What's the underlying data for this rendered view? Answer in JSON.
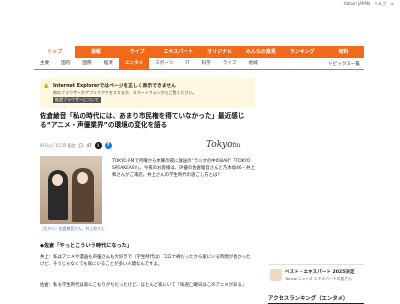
{
  "topbar": {
    "links": [
      "Yahoo! JAPAN",
      "ヘルプ",
      "◎"
    ]
  },
  "nav_primary": [
    "トップ",
    "速報",
    "ライブ",
    "エキスパート",
    "オリジナル",
    "みんなの意見",
    "ランキング",
    "有料"
  ],
  "nav_secondary": [
    "主要",
    "国内",
    "国際",
    "経済",
    "エンタメ",
    "スポーツ",
    "IT",
    "科学",
    "ライフ",
    "地域"
  ],
  "nav_secondary_active": "エンタメ",
  "topics_link": "トピックス一覧",
  "notice": {
    "heading": "Internet Explorerではページを正しく表示できません",
    "text": "他のブラウザーかアプリでアクセスするか、スマートフォンからご覧ください。",
    "link": "推奨ブラウザーについて"
  },
  "article": {
    "title": "佐倉綾音「私の時代には、あまり市民権を得ていなかった」最近感じる“アニメ・声優業界”の環境の変化を語る",
    "date": "9/3(火) 15:35 配信",
    "comments": "47",
    "logo": "Tokyo",
    "logo_suffix": "fm",
    "caption": "（左から）佐倉綾音さん、井上和さん",
    "lead": "TOKYO FMで月曜から木曜の夜に放送の“ラジオの中のBAR”「TOKYO SPEAKEASY」。今夜のお客様は、声優の佐倉綾音さんと乃木坂46・井上和さんがご来店。井上さんの学生時代の過ごし方とは？",
    "subhead": "◆佐倉「やっとこういう時代になった」",
    "body1": "井上：私はアニメや漫画も声優さんも大好きで（学生時代は）コロナ禍だったから家にいる時間が長かったけど、そうじゃなくても家にいることが多い人間なんですよ。",
    "body2": "佐倉：私も学生時代は家にこもりがちだったけど、ほとんど家にいて「毎週◯曜日はこのアニメがある」"
  },
  "sidebar": {
    "card_title": "ベスト・エキスパート 2025決定",
    "card_sub": "Yahoo!ニュース エキスパートの皆さん",
    "ranking_title": "アクセスランキング（エンタメ）"
  }
}
